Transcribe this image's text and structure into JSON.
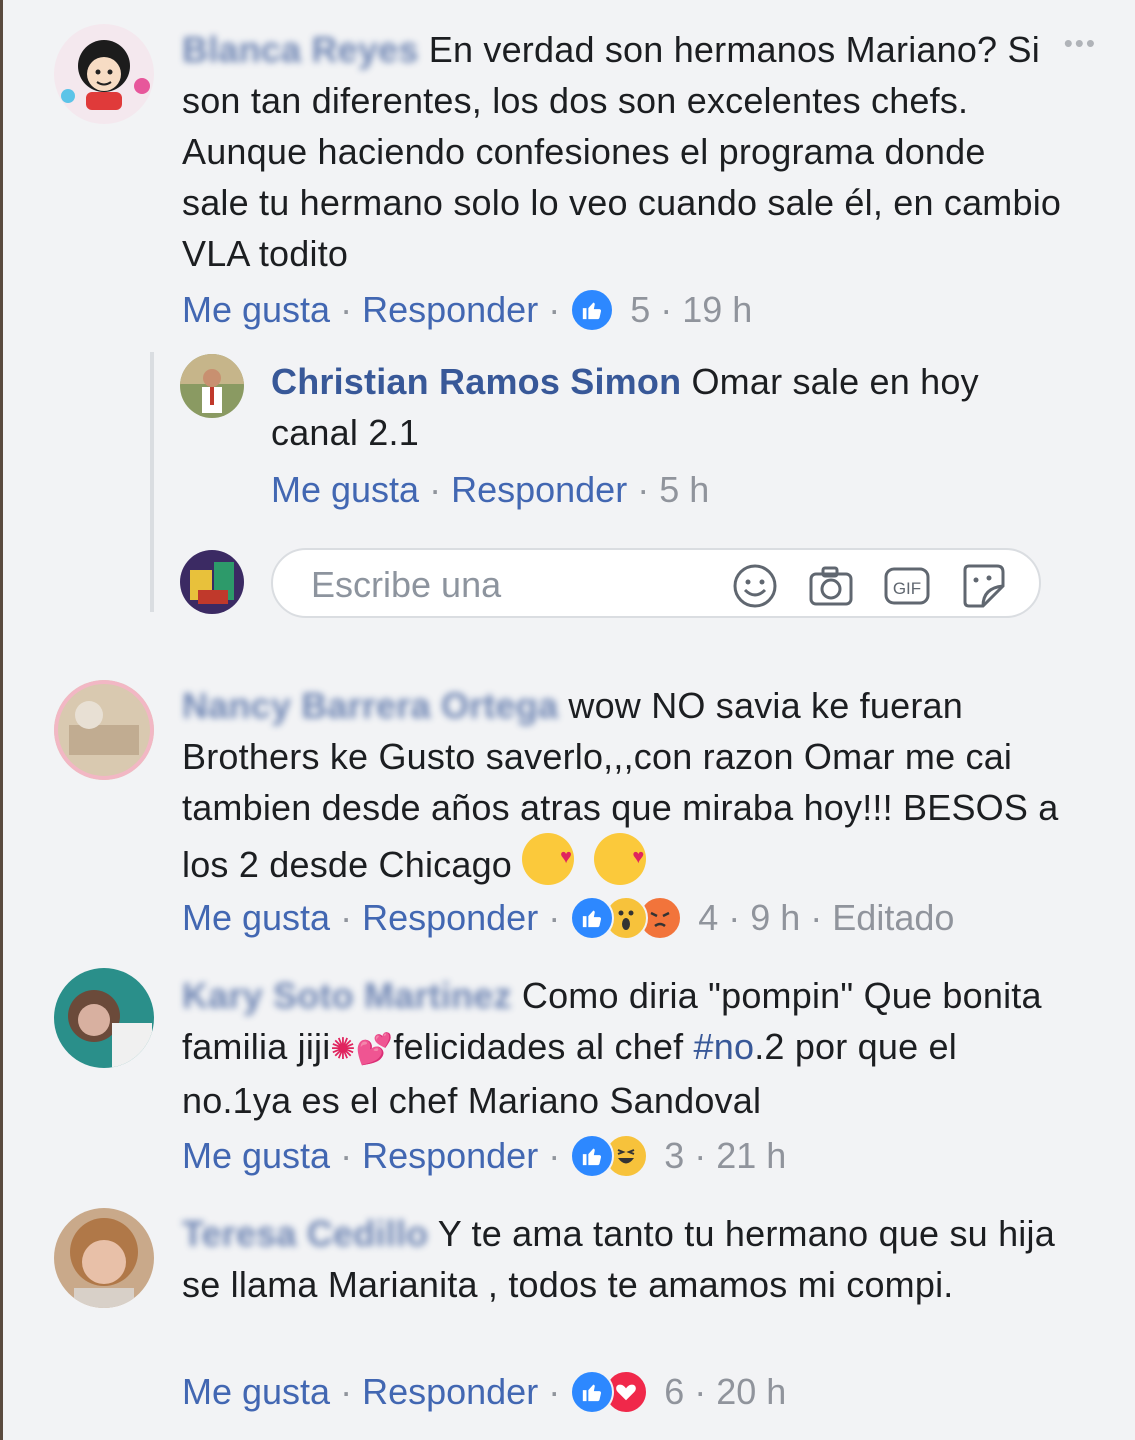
{
  "actions": {
    "like": "Me gusta",
    "reply": "Responder",
    "dot": "·"
  },
  "comments": [
    {
      "author": "Blanca Reyes",
      "text": "En verdad son hermanos Mariano? Si son tan diferentes, los dos son excelentes chefs. Aunque haciendo confesiones el programa donde sale tu hermano solo lo veo cuando sale él, en cambio VLA todito",
      "reactions": [
        "like-icon"
      ],
      "count": "5",
      "time": "19 h"
    },
    {
      "author": "Nancy Barrera Ortega",
      "text": "wow NO savia ke fueran Brothers ke Gusto saverlo,,,con razon Omar me cai tambien desde años atras que miraba hoy!!! BESOS a los 2 desde Chicago",
      "reactions": [
        "like-icon",
        "wow-icon",
        "angry-icon"
      ],
      "count": "4",
      "time": "9 h",
      "edited": "Editado"
    },
    {
      "author": "Kary Soto Martinez",
      "text_a": "Como diria \"pompin\" Que bonita familia jiji",
      "text_b": "felicidades al chef ",
      "hashtag": "#no",
      "text_c": ".2 por que el no.1ya es el chef Mariano Sandoval",
      "reactions": [
        "like-icon",
        "haha-icon"
      ],
      "count": "3",
      "time": "21 h"
    },
    {
      "author": "Teresa Cedillo",
      "text": "Y te ama tanto tu hermano que su hija se llama Marianita , todos te amamos mi compi.",
      "reactions": [
        "like-icon",
        "love-icon"
      ],
      "count": "6",
      "time": "20 h"
    }
  ],
  "reply": {
    "author": "Christian Ramos Simon",
    "text": "Omar sale en hoy canal 2.1",
    "time": "5 h"
  },
  "reply_box": {
    "placeholder": "Escribe una",
    "icons": [
      "smiley-icon",
      "camera-icon",
      "gif-icon",
      "sticker-icon"
    ]
  },
  "colors": {
    "link": "#4267b2",
    "meta": "#90949c",
    "background": "#f2f3f5"
  }
}
